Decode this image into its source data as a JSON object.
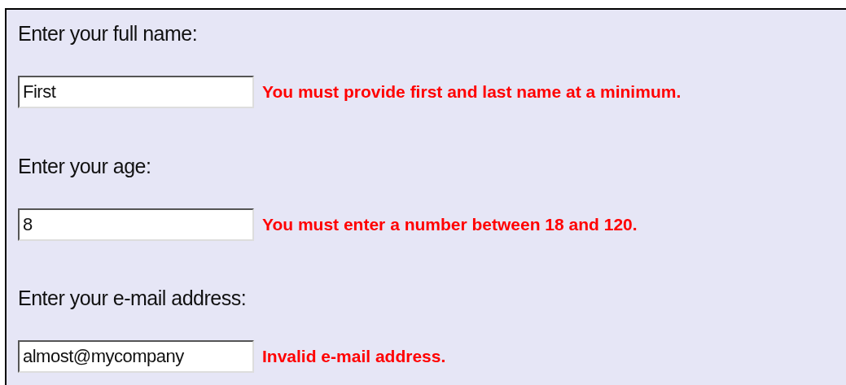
{
  "fields": [
    {
      "label": "Enter your full name:",
      "value": "First",
      "error": "You must provide first and last name at a minimum."
    },
    {
      "label": "Enter your age:",
      "value": "8",
      "error": "You must enter a number between 18 and 120."
    },
    {
      "label": "Enter your e-mail address:",
      "value": "almost@mycompany",
      "error": "Invalid e-mail address."
    }
  ]
}
